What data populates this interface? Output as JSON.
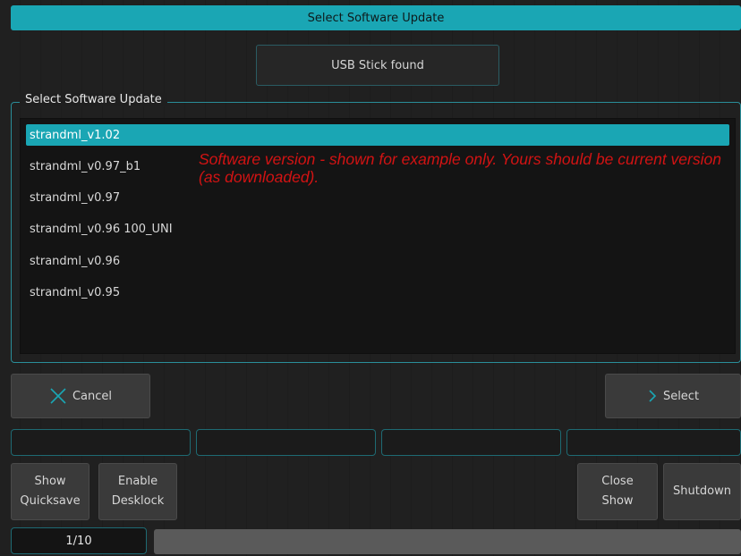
{
  "title": "Select Software Update",
  "usb_status": "USB Stick found",
  "group_title": "Select Software Update",
  "list_items": [
    "strandml_v1.02",
    "strandml_v0.97_b1",
    "strandml_v0.97",
    "strandml_v0.96 100_UNI",
    "strandml_v0.96",
    "strandml_v0.95"
  ],
  "selected_index": 0,
  "annotation": "Software version - shown for example only. Yours should be current version (as downloaded).",
  "buttons": {
    "cancel": "Cancel",
    "select": "Select",
    "show_quicksave_line1": "Show",
    "show_quicksave_line2": "Quicksave",
    "enable_desklock_line1": "Enable",
    "enable_desklock_line2": "Desklock",
    "close_show_line1": "Close",
    "close_show_line2": "Show",
    "shutdown": "Shutdown"
  },
  "page_indicator": "1/10",
  "colors": {
    "accent": "#1aa6b4",
    "annotation": "#d21313",
    "background": "#1f1f1f"
  },
  "icons": {
    "cancel": "close-x-icon",
    "select": "chevron-right-icon"
  }
}
